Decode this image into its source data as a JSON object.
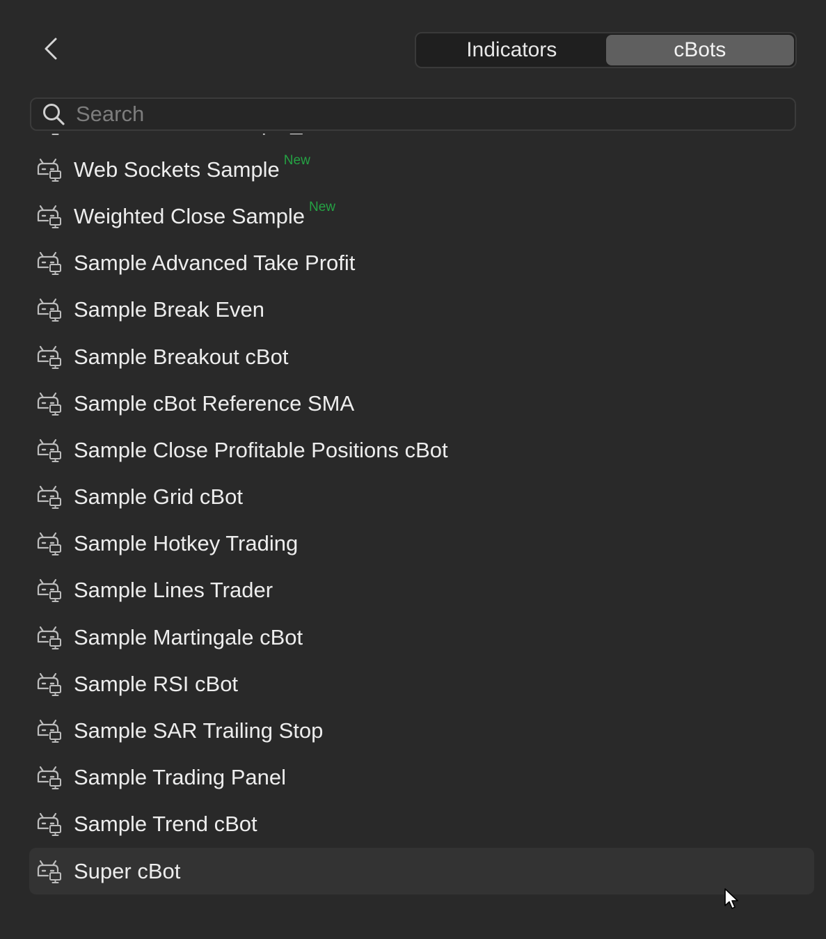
{
  "header": {
    "back_icon": "chevron-left-icon",
    "tabs": [
      {
        "label": "Indicators",
        "active": false
      },
      {
        "label": "cBots",
        "active": true
      }
    ]
  },
  "search": {
    "placeholder": "Search",
    "value": "",
    "icon": "search-icon"
  },
  "colors": {
    "background": "#292929",
    "active_tab": "#5f5f5f",
    "new_badge": "#25a244",
    "hover_row": "#333333"
  },
  "list": {
    "item_icon": "robot-icon",
    "items": [
      {
        "label": "Web Sockets Example_withSourceCode",
        "badge": ""
      },
      {
        "label": "Web Sockets Sample",
        "badge": "New"
      },
      {
        "label": "Weighted Close Sample",
        "badge": "New"
      },
      {
        "label": "Sample Advanced Take Profit",
        "badge": ""
      },
      {
        "label": "Sample Break Even",
        "badge": ""
      },
      {
        "label": "Sample Breakout cBot",
        "badge": ""
      },
      {
        "label": "Sample cBot Reference SMA",
        "badge": ""
      },
      {
        "label": "Sample Close Profitable Positions cBot",
        "badge": ""
      },
      {
        "label": "Sample Grid cBot",
        "badge": ""
      },
      {
        "label": "Sample Hotkey Trading",
        "badge": ""
      },
      {
        "label": "Sample Lines Trader",
        "badge": ""
      },
      {
        "label": "Sample Martingale cBot",
        "badge": ""
      },
      {
        "label": "Sample RSI cBot",
        "badge": ""
      },
      {
        "label": "Sample SAR Trailing Stop",
        "badge": ""
      },
      {
        "label": "Sample Trading Panel",
        "badge": ""
      },
      {
        "label": "Sample Trend cBot",
        "badge": ""
      },
      {
        "label": "Super cBot",
        "badge": "",
        "hovered": true
      }
    ]
  }
}
